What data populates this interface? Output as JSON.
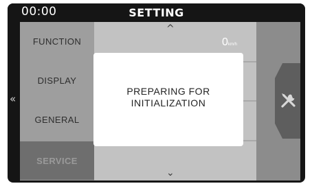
{
  "status_bar": {
    "time": "00:00",
    "title": "SETTING"
  },
  "nav": {
    "back_glyph": "«",
    "next_glyph": "›",
    "scroll_up_glyph": "^",
    "scroll_down_glyph": "⌄"
  },
  "menu": {
    "items": [
      {
        "label": "FUNCTION",
        "active": false
      },
      {
        "label": "DISPLAY",
        "active": false
      },
      {
        "label": "GENERAL",
        "active": false
      },
      {
        "label": "SERVICE",
        "active": true
      }
    ]
  },
  "speed": {
    "value": "0",
    "unit": "km/h"
  },
  "service_tab": {
    "icon": "wrench-screwdriver-icon"
  },
  "dialog": {
    "line1": "PREPARING FOR",
    "line2": "INITIALIZATION"
  },
  "colors": {
    "background": "#151515",
    "menu": "#9e9e9e",
    "active_menu": "#6e6e6e",
    "dialog": "#ffffff"
  }
}
